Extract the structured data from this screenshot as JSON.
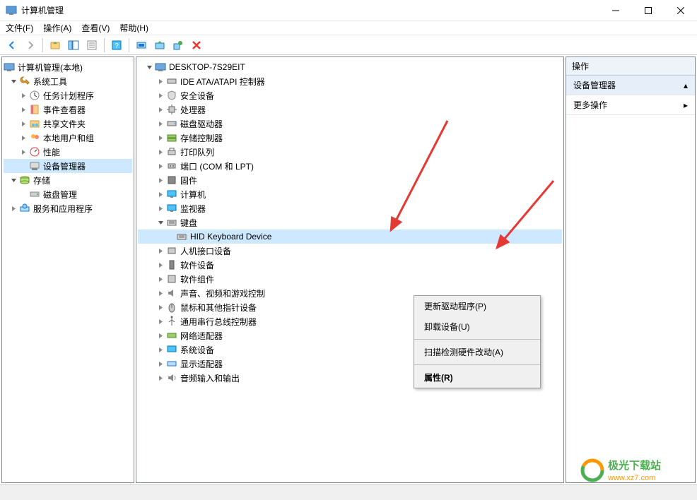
{
  "title": "计算机管理",
  "menus": [
    "文件(F)",
    "操作(A)",
    "查看(V)",
    "帮助(H)"
  ],
  "leftTree": {
    "root": "计算机管理(本地)",
    "c0": "系统工具",
    "c0_0": "任务计划程序",
    "c0_1": "事件查看器",
    "c0_2": "共享文件夹",
    "c0_3": "本地用户和组",
    "c0_4": "性能",
    "c0_5": "设备管理器",
    "c1": "存储",
    "c1_0": "磁盘管理",
    "c2": "服务和应用程序"
  },
  "devRoot": "DESKTOP-7S29EIT",
  "devs": {
    "d0": "IDE ATA/ATAPI 控制器",
    "d1": "安全设备",
    "d2": "处理器",
    "d3": "磁盘驱动器",
    "d4": "存储控制器",
    "d5": "打印队列",
    "d6": "端口 (COM 和 LPT)",
    "d7": "固件",
    "d8": "计算机",
    "d9": "监视器",
    "d10": "键盘",
    "d10_0": "HID Keyboard Device",
    "d11": "人机接口设备",
    "d12": "软件设备",
    "d13": "软件组件",
    "d14": "声音、视频和游戏控制",
    "d15": "鼠标和其他指针设备",
    "d16": "通用串行总线控制器",
    "d17": "网络适配器",
    "d18": "系统设备",
    "d19": "显示适配器",
    "d20": "音频输入和输出"
  },
  "ctx": {
    "c0": "更新驱动程序(P)",
    "c1": "卸载设备(U)",
    "c2": "扫描检测硬件改动(A)",
    "c3": "属性(R)"
  },
  "actions": {
    "header": "操作",
    "item0": "设备管理器",
    "item1": "更多操作"
  },
  "watermark": {
    "line1": "极光下载站",
    "line2": "www.xz7.com"
  }
}
